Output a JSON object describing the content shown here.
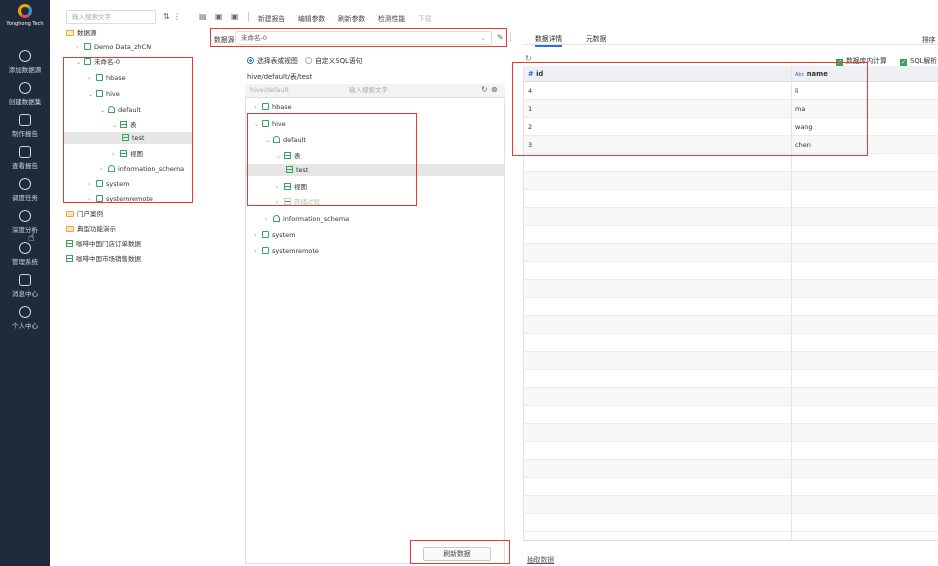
{
  "nav": {
    "logo_text": "Yonghong Tech",
    "items": [
      "添加数据源",
      "创建数据集",
      "制作报告",
      "查看报告",
      "调度任务",
      "深度分析",
      "管理系统",
      "消息中心",
      "个人中心"
    ]
  },
  "left_tree": {
    "search_placeholder": "输入搜索文字",
    "root": "数据源",
    "demo": "Demo Data_zhCN",
    "unnamed": "未命名-0",
    "hbase": "hbase",
    "hive": "hive",
    "default": "default",
    "table_group": "表",
    "test": "test",
    "view": "视图",
    "info_schema": "information_schema",
    "system": "system",
    "systemremote": "systemremote",
    "portal": "门户案例",
    "typical": "典型功能演示",
    "cafe_orders": "咖啡中国门店订单数据",
    "cafe_market": "咖啡中国市场销售数据"
  },
  "toolbar": {
    "new_report": "新建报告",
    "edit_params": "编辑参数",
    "refresh_params": "刷新参数",
    "check_perf": "检测性能",
    "download": "下载"
  },
  "middle": {
    "datasource_label": "数据源:",
    "datasource_value": "未命名-0",
    "radio_table": "选择表或视图",
    "radio_sql": "自定义SQL语句",
    "path": "hive/default/表/test",
    "search_path": "hive/default",
    "search_placeholder": "输入搜索文字",
    "tree": {
      "hbase": "hbase",
      "hive": "hive",
      "default": "default",
      "table_group": "表",
      "test": "test",
      "view": "视图",
      "proc": "存储过程",
      "info_schema": "information_schema",
      "system": "system",
      "systemremote": "systemremote"
    },
    "refresh_button": "刷新数据"
  },
  "right": {
    "tab_detail": "数据详情",
    "tab_meta": "元数据",
    "sort": "排序",
    "chk_db_calc": "数据库内计算",
    "chk_sql": "SQL解析",
    "col_id_prefix": "#",
    "col_id": "id",
    "col_name_prefix": "Abc",
    "col_name": "name",
    "rows": [
      {
        "id": "4",
        "name": "li"
      },
      {
        "id": "1",
        "name": "ma"
      },
      {
        "id": "2",
        "name": "wang"
      },
      {
        "id": "3",
        "name": "chen"
      }
    ],
    "extract": "抽取数据"
  },
  "colors": {
    "nav_bg": "#1f2a3c",
    "accent": "#2a6fdb",
    "highlight_box": "#e53935",
    "db_green": "#3aa35a"
  }
}
